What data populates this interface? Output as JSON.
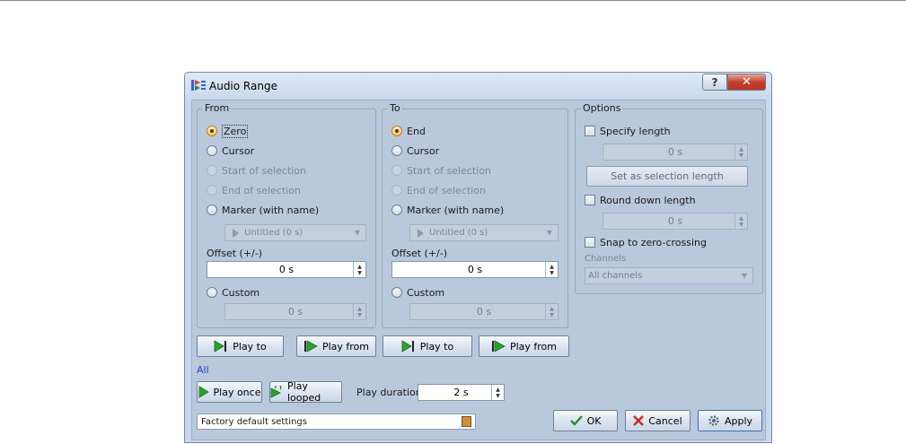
{
  "window": {
    "title": "Audio Range",
    "help_label": "?",
    "close_label": "✕"
  },
  "from": {
    "group_label": "From",
    "options": [
      {
        "label": "Zero",
        "state": "checked"
      },
      {
        "label": "Cursor",
        "state": "enabled"
      },
      {
        "label": "Start of selection",
        "state": "disabled"
      },
      {
        "label": "End of selection",
        "state": "disabled"
      },
      {
        "label": "Marker (with name)",
        "state": "enabled"
      }
    ],
    "marker_value": "Untitled (0 s)",
    "offset_label": "Offset (+/-)",
    "offset_value": "0 s",
    "custom_label": "Custom",
    "custom_value": "0 s"
  },
  "to": {
    "group_label": "To",
    "options": [
      {
        "label": "End",
        "state": "checked"
      },
      {
        "label": "Cursor",
        "state": "enabled"
      },
      {
        "label": "Start of selection",
        "state": "disabled"
      },
      {
        "label": "End of selection",
        "state": "disabled"
      },
      {
        "label": "Marker (with name)",
        "state": "enabled"
      }
    ],
    "marker_value": "Untitled (0 s)",
    "offset_label": "Offset (+/-)",
    "offset_value": "0 s",
    "custom_label": "Custom",
    "custom_value": "0 s"
  },
  "options": {
    "group_label": "Options",
    "specify_length_label": "Specify length",
    "length_value": "0 s",
    "set_selection_length_label": "Set as selection length",
    "round_down_label": "Round down length",
    "round_value": "0 s",
    "snap_label": "Snap to zero-crossing",
    "channels_label": "Channels",
    "channels_value": "All channels"
  },
  "play": {
    "from_play_to": "Play to",
    "from_play_from": "Play from",
    "to_play_to": "Play to",
    "to_play_from": "Play from",
    "all_label": "All",
    "play_once": "Play once",
    "play_looped": "Play looped",
    "duration_label": "Play duration",
    "duration_value": "2 s"
  },
  "footer": {
    "preset_value": "Factory default settings",
    "ok_label": "OK",
    "cancel_label": "Cancel",
    "apply_label": "Apply"
  },
  "colors": {
    "accent_radio": "#f4c56a",
    "ok_check": "#2e8b2e",
    "cancel_x": "#c62828",
    "play_green": "#2da12d"
  }
}
